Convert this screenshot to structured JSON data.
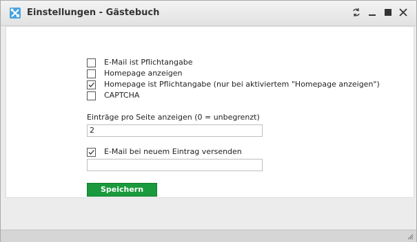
{
  "window": {
    "title": "Einstellungen - Gästebuch",
    "app_icon": "tools-icon",
    "controls": [
      "refresh-icon",
      "minimize-icon",
      "maximize-icon",
      "close-icon"
    ]
  },
  "options": [
    {
      "label": "E-Mail ist Pflichtangabe",
      "checked": false
    },
    {
      "label": "Homepage anzeigen",
      "checked": false
    },
    {
      "label": "Homepage ist Pflichtangabe (nur bei aktiviertem \"Homepage anzeigen\")",
      "checked": true
    },
    {
      "label": "CAPTCHA",
      "checked": false
    }
  ],
  "entries_per_page": {
    "label": "Einträge pro Seite anzeigen (0 = unbegrenzt)",
    "value": "2"
  },
  "email_notify": {
    "label": "E-Mail bei neuem Eintrag versenden",
    "checked": true,
    "value": ""
  },
  "save_label": "Speichern",
  "colors": {
    "accent": "#1a9a3c",
    "titlebar": "#e8e8e8"
  }
}
